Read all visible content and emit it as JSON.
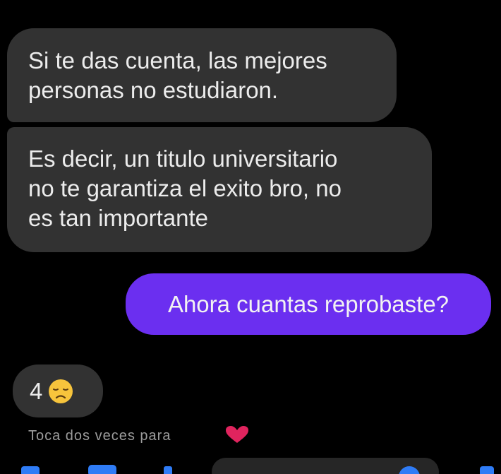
{
  "messages": [
    {
      "direction": "incoming",
      "text": "Si te das cuenta, las mejores\npersonas no estudiaron."
    },
    {
      "direction": "incoming",
      "text": "Es decir, un titulo universitario\nno te garantiza el exito bro, no\nes tan importante"
    },
    {
      "direction": "outgoing",
      "text": "Ahora cuantas reprobaste?"
    },
    {
      "direction": "incoming",
      "text": "4",
      "emoji": "disappointed-face-emoji"
    }
  ],
  "reaction_hint": {
    "text": "Toca dos veces para",
    "icon": "heart-icon"
  },
  "colors": {
    "background": "#000000",
    "incoming_bubble": "#323232",
    "outgoing_bubble": "#6b2ff0",
    "accent": "#2f7cf6",
    "heart": "#e0245e"
  }
}
